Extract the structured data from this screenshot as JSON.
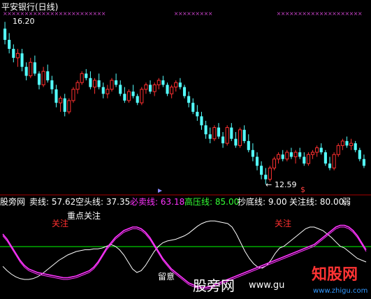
{
  "title": "平安银行(日线)",
  "price_high_label": "16.20",
  "price_low_label": "12.59",
  "arrow_low": "←",
  "sell_marker": "$",
  "indicator_row": {
    "name": "股旁网",
    "maixian": "卖线: 57.62",
    "kongtou": "空头线: 37.35",
    "bimai": "必卖线: 63.18",
    "gaoya": "高压线: 85.00",
    "chaodi": "抄底线: 9.00",
    "guanzhu": "关注线: 80.00",
    "ruo": "弱"
  },
  "osc_labels": {
    "guanzhu1": "关注",
    "guanzhu2": "关注",
    "zhongdian": "重点关注",
    "liuyi": "留意"
  },
  "watermark": {
    "gupang": "股旁网",
    "url": "www.gu",
    "zhigu": "知股网",
    "zhigu_url": "www.zhigu.com"
  },
  "colors": {
    "bg": "#000000",
    "up": "#ff3030",
    "down": "#54ffff",
    "title": "#ffffff",
    "maixian": "#ffffff",
    "kongtou": "#ffffff",
    "bimai": "#ff33ff",
    "gaoya": "#33ff33",
    "chaodi": "#ffffff",
    "guanzhu": "#ffffff",
    "marker": "#cc44cc",
    "grid_line": "#00ff00",
    "divider": "#aa0000"
  },
  "chart_data": [
    {
      "type": "candlestick",
      "title": "平安银行(日线)",
      "price_max": 16.2,
      "price_min": 12.59,
      "ohlc": [
        [
          16.05,
          16.2,
          15.7,
          15.8
        ],
        [
          15.8,
          15.95,
          15.5,
          15.6
        ],
        [
          15.6,
          15.7,
          15.3,
          15.4
        ],
        [
          15.4,
          15.6,
          15.2,
          15.5
        ],
        [
          15.5,
          15.6,
          15.1,
          15.2
        ],
        [
          15.2,
          15.3,
          14.9,
          15.0
        ],
        [
          15.0,
          15.4,
          14.95,
          15.3
        ],
        [
          15.3,
          15.45,
          15.0,
          15.05
        ],
        [
          15.05,
          15.1,
          14.7,
          14.8
        ],
        [
          14.8,
          15.2,
          14.75,
          15.1
        ],
        [
          15.1,
          15.25,
          14.85,
          14.9
        ],
        [
          14.9,
          15.0,
          14.6,
          14.7
        ],
        [
          14.7,
          14.8,
          14.3,
          14.4
        ],
        [
          14.4,
          14.55,
          14.2,
          14.5
        ],
        [
          14.5,
          14.6,
          14.1,
          14.2
        ],
        [
          14.2,
          14.5,
          14.15,
          14.45
        ],
        [
          14.45,
          14.75,
          14.4,
          14.7
        ],
        [
          14.7,
          14.9,
          14.6,
          14.85
        ],
        [
          14.85,
          15.1,
          14.8,
          15.05
        ],
        [
          15.05,
          15.15,
          14.9,
          14.95
        ],
        [
          14.95,
          15.1,
          14.7,
          14.75
        ],
        [
          14.75,
          14.95,
          14.6,
          14.9
        ],
        [
          14.9,
          15.05,
          14.7,
          14.75
        ],
        [
          14.75,
          14.85,
          14.5,
          14.6
        ],
        [
          14.6,
          14.8,
          14.5,
          14.7
        ],
        [
          14.7,
          14.95,
          14.65,
          14.9
        ],
        [
          14.9,
          15.05,
          14.75,
          14.8
        ],
        [
          14.8,
          14.9,
          14.55,
          14.6
        ],
        [
          14.6,
          14.75,
          14.4,
          14.45
        ],
        [
          14.45,
          14.7,
          14.4,
          14.65
        ],
        [
          14.65,
          14.8,
          14.5,
          14.55
        ],
        [
          14.55,
          14.6,
          14.35,
          14.4
        ],
        [
          14.4,
          14.75,
          14.35,
          14.7
        ],
        [
          14.7,
          14.85,
          14.6,
          14.8
        ],
        [
          14.8,
          14.9,
          14.6,
          14.65
        ],
        [
          14.65,
          14.85,
          14.55,
          14.8
        ],
        [
          14.8,
          14.95,
          14.7,
          14.9
        ],
        [
          14.9,
          15.0,
          14.75,
          14.8
        ],
        [
          14.8,
          14.85,
          14.55,
          14.6
        ],
        [
          14.6,
          14.8,
          14.5,
          14.75
        ],
        [
          14.75,
          14.9,
          14.65,
          14.85
        ],
        [
          14.85,
          14.95,
          14.7,
          14.75
        ],
        [
          14.75,
          14.8,
          14.5,
          14.55
        ],
        [
          14.55,
          14.65,
          14.3,
          14.4
        ],
        [
          14.4,
          14.5,
          14.15,
          14.2
        ],
        [
          14.2,
          14.35,
          14.0,
          14.1
        ],
        [
          14.1,
          14.2,
          13.8,
          13.9
        ],
        [
          13.9,
          14.0,
          13.6,
          13.7
        ],
        [
          13.7,
          13.85,
          13.5,
          13.6
        ],
        [
          13.6,
          13.9,
          13.55,
          13.85
        ],
        [
          13.85,
          13.95,
          13.6,
          13.65
        ],
        [
          13.65,
          13.75,
          13.4,
          13.5
        ],
        [
          13.5,
          13.9,
          13.45,
          13.85
        ],
        [
          13.85,
          13.95,
          13.55,
          13.6
        ],
        [
          13.6,
          13.75,
          13.4,
          13.45
        ],
        [
          13.45,
          13.85,
          13.4,
          13.8
        ],
        [
          13.8,
          13.9,
          13.5,
          13.55
        ],
        [
          13.55,
          13.7,
          13.3,
          13.35
        ],
        [
          13.35,
          13.5,
          13.1,
          13.2
        ],
        [
          13.2,
          13.3,
          12.9,
          13.0
        ],
        [
          13.0,
          13.1,
          12.7,
          12.8
        ],
        [
          12.8,
          12.95,
          12.59,
          12.7
        ],
        [
          12.7,
          13.0,
          12.65,
          12.95
        ],
        [
          12.95,
          13.2,
          12.9,
          13.15
        ],
        [
          13.15,
          13.3,
          13.05,
          13.25
        ],
        [
          13.25,
          13.35,
          13.1,
          13.15
        ],
        [
          13.15,
          13.35,
          13.1,
          13.3
        ],
        [
          13.3,
          13.4,
          13.15,
          13.2
        ],
        [
          13.2,
          13.35,
          13.05,
          13.3
        ],
        [
          13.3,
          13.4,
          13.15,
          13.2
        ],
        [
          13.2,
          13.3,
          13.0,
          13.05
        ],
        [
          13.05,
          13.3,
          13.0,
          13.25
        ],
        [
          13.25,
          13.35,
          13.15,
          13.3
        ],
        [
          13.3,
          13.45,
          13.2,
          13.4
        ],
        [
          13.4,
          13.5,
          13.25,
          13.3
        ],
        [
          13.3,
          13.35,
          13.0,
          13.05
        ],
        [
          13.05,
          13.2,
          12.9,
          12.95
        ],
        [
          12.95,
          13.3,
          12.9,
          13.25
        ],
        [
          13.25,
          13.5,
          13.2,
          13.45
        ],
        [
          13.45,
          13.6,
          13.35,
          13.55
        ],
        [
          13.55,
          13.65,
          13.4,
          13.45
        ],
        [
          13.45,
          13.6,
          13.35,
          13.5
        ],
        [
          13.5,
          13.55,
          13.3,
          13.35
        ],
        [
          13.35,
          13.4,
          13.1,
          13.15
        ],
        [
          13.15,
          13.25,
          12.95,
          13.0
        ]
      ]
    },
    {
      "type": "line",
      "title": "",
      "ylim": [
        0,
        100
      ],
      "reference_line": 57.62,
      "series": [
        {
          "name": "卖线",
          "color": "#ffffff",
          "values": [
            35,
            30,
            26,
            23,
            21,
            20,
            20,
            21,
            23,
            26,
            30,
            34,
            38,
            42,
            45,
            48,
            50,
            52,
            53,
            54,
            54,
            55,
            55,
            56,
            58,
            60,
            58,
            54,
            48,
            40,
            32,
            28,
            30,
            36,
            44,
            52,
            58,
            62,
            64,
            65,
            66,
            68,
            70,
            73,
            77,
            81,
            84,
            86,
            87,
            87,
            86,
            85,
            84,
            80,
            72,
            62,
            52,
            44,
            38,
            34,
            33,
            36,
            42,
            50,
            56,
            58,
            62,
            66,
            70,
            74,
            78,
            80,
            80,
            78,
            76,
            72,
            68,
            63,
            58,
            56,
            52,
            48,
            44,
            42,
            40
          ]
        },
        {
          "name": "空头线",
          "color": "#ff33ff",
          "values": [
            70,
            64,
            56,
            48,
            40,
            34,
            30,
            28,
            26,
            25,
            24,
            23,
            22,
            21,
            20,
            20,
            21,
            22,
            24,
            26,
            28,
            32,
            38,
            46,
            54,
            60,
            66,
            70,
            74,
            76,
            78,
            78,
            76,
            72,
            66,
            58,
            50,
            42,
            36,
            30,
            26,
            22,
            18,
            14,
            12,
            10,
            9,
            9,
            10,
            12,
            14,
            16,
            18,
            20,
            22,
            24,
            26,
            28,
            30,
            32,
            34,
            36,
            38,
            40,
            42,
            44,
            46,
            48,
            50,
            52,
            54,
            56,
            58,
            62,
            66,
            70,
            74,
            78,
            80,
            80,
            78,
            74,
            68,
            60,
            52
          ]
        },
        {
          "name": "必卖线",
          "color": "#ff33ff",
          "values": [
            72,
            66,
            58,
            50,
            42,
            36,
            32,
            30,
            28,
            27,
            26,
            25,
            24,
            23,
            22,
            22,
            23,
            24,
            26,
            28,
            30,
            34,
            40,
            48,
            56,
            62,
            68,
            72,
            76,
            78,
            80,
            80,
            78,
            74,
            68,
            60,
            52,
            44,
            38,
            32,
            28,
            24,
            20,
            16,
            14,
            12,
            11,
            11,
            12,
            14,
            16,
            18,
            20,
            22,
            24,
            26,
            28,
            30,
            32,
            34,
            36,
            38,
            40,
            42,
            44,
            46,
            48,
            50,
            52,
            54,
            56,
            58,
            60,
            64,
            68,
            72,
            76,
            80,
            82,
            82,
            80,
            76,
            70,
            62,
            54
          ]
        }
      ]
    }
  ]
}
